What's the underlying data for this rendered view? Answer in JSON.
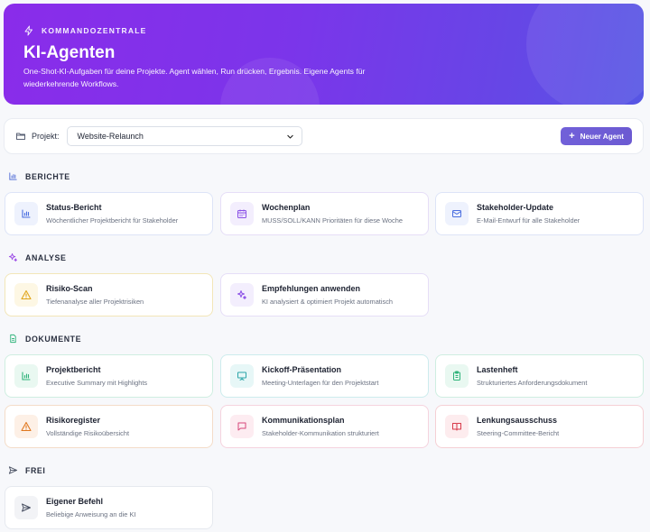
{
  "hero": {
    "eyebrow": "KOMMANDOZENTRALE",
    "title": "KI-Agenten",
    "description": "One-Shot-KI-Aufgaben für deine Projekte. Agent wählen, Run drücken, Ergebnis. Eigene Agents für wiederkehrende Workflows."
  },
  "project": {
    "label": "Projekt:",
    "selected": "Website-Relaunch",
    "new_agent_label": "Neuer Agent"
  },
  "sections": {
    "berichte": "BERICHTE",
    "analyse": "ANALYSE",
    "dokumente": "DOKUMENTE",
    "frei": "FREI"
  },
  "cards": {
    "status_bericht": {
      "title": "Status-Bericht",
      "subtitle": "Wöchentlicher Projektbericht für Stakeholder",
      "icon": "bar-chart-icon"
    },
    "wochenplan": {
      "title": "Wochenplan",
      "subtitle": "MUSS/SOLL/KANN Prioritäten für diese Woche",
      "icon": "calendar-icon"
    },
    "stakeholder_update": {
      "title": "Stakeholder-Update",
      "subtitle": "E-Mail-Entwurf für alle Stakeholder",
      "icon": "mail-icon"
    },
    "risiko_scan": {
      "title": "Risiko-Scan",
      "subtitle": "Tiefenanalyse aller Projektrisiken",
      "icon": "warning-icon"
    },
    "empfehlungen": {
      "title": "Empfehlungen anwenden",
      "subtitle": "KI analysiert & optimiert Projekt automatisch",
      "icon": "sparkles-icon"
    },
    "projektbericht": {
      "title": "Projektbericht",
      "subtitle": "Executive Summary mit Highlights",
      "icon": "bar-chart-icon"
    },
    "kickoff": {
      "title": "Kickoff-Präsentation",
      "subtitle": "Meeting-Unterlagen für den Projektstart",
      "icon": "presentation-icon"
    },
    "lastenheft": {
      "title": "Lastenheft",
      "subtitle": "Strukturiertes Anforderungsdokument",
      "icon": "clipboard-icon"
    },
    "risikoregister": {
      "title": "Risikoregister",
      "subtitle": "Vollständige Risikoübersicht",
      "icon": "warning-icon"
    },
    "kommunikationsplan": {
      "title": "Kommunikationsplan",
      "subtitle": "Stakeholder-Kommunikation strukturiert",
      "icon": "chat-icon"
    },
    "lenkungsausschuss": {
      "title": "Lenkungsausschuss",
      "subtitle": "Steering-Committee-Bericht",
      "icon": "book-icon"
    },
    "eigener_befehl": {
      "title": "Eigener Befehl",
      "subtitle": "Beliebige Anweisung an die KI",
      "icon": "send-icon"
    }
  },
  "colors": {
    "hero_gradient_start": "#8a2cea",
    "hero_gradient_end": "#5656e4",
    "button": "#6e63d8"
  }
}
